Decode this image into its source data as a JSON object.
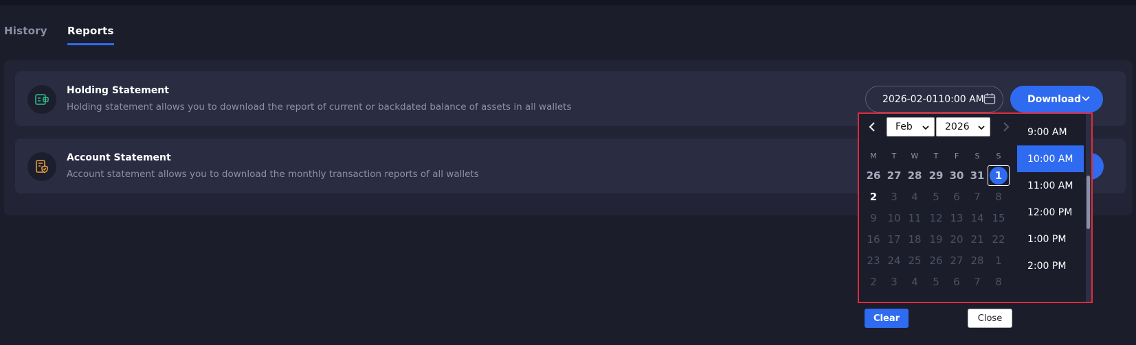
{
  "tabs": [
    {
      "label": "History",
      "active": false
    },
    {
      "label": "Reports",
      "active": true
    }
  ],
  "cards": [
    {
      "icon": "wallet-statement-icon",
      "title": "Holding Statement",
      "description": "Holding statement allows you to download the report of current or backdated balance of assets in all wallets"
    },
    {
      "icon": "shield-document-icon",
      "title": "Account Statement",
      "description": "Account statement allows you to download the monthly transaction reports of all wallets"
    }
  ],
  "date_field": {
    "value": "2026-02-0110:00 AM",
    "icon": "calendar-icon"
  },
  "download_button": {
    "label": "Download",
    "icon": "chevron-down-icon"
  },
  "datepicker": {
    "month_select": {
      "selected": "Feb"
    },
    "year_select": {
      "selected": "2026"
    },
    "weekdays": [
      "M",
      "T",
      "W",
      "T",
      "F",
      "S",
      "S"
    ],
    "weeks": [
      [
        "26",
        "27",
        "28",
        "29",
        "30",
        "31",
        "1"
      ],
      [
        "2",
        "3",
        "4",
        "5",
        "6",
        "7",
        "8"
      ],
      [
        "9",
        "10",
        "11",
        "12",
        "13",
        "14",
        "15"
      ],
      [
        "16",
        "17",
        "18",
        "19",
        "20",
        "21",
        "22"
      ],
      [
        "23",
        "24",
        "25",
        "26",
        "27",
        "28",
        "1"
      ],
      [
        "2",
        "3",
        "4",
        "5",
        "6",
        "7",
        "8"
      ]
    ],
    "selected_day": "1",
    "times": [
      "9:00 AM",
      "10:00 AM",
      "11:00 AM",
      "12:00 PM",
      "1:00 PM",
      "2:00 PM"
    ],
    "selected_time": "10:00 AM",
    "clear_label": "Clear",
    "close_label": "Close"
  },
  "colors": {
    "background": "#1b1d2b",
    "card": "#2a2c41",
    "accent": "#2f6bf0",
    "highlight_border": "#e02c3a",
    "muted_text": "#8c91a8"
  }
}
